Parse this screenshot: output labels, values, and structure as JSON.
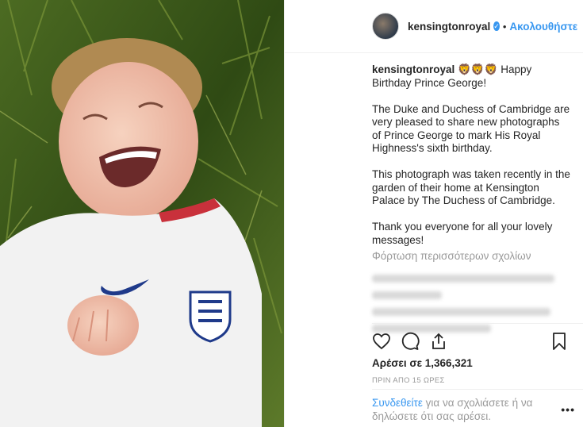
{
  "header": {
    "username": "kensingtonroyal",
    "verified_icon": "verified-badge-icon",
    "separator": "•",
    "follow_label": "Ακολουθήστε"
  },
  "caption": {
    "username": "kensingtonroyal",
    "emojis": "🦁🦁🦁",
    "paragraphs": [
      "Happy Birthday Prince George!",
      "The Duke and Duchess of Cambridge are very pleased to share new photographs of Prince George to mark His Royal Highness's sixth birthday.",
      "This photograph was taken recently in the garden of their home at Kensington Palace by The Duchess of Cambridge.",
      "Thank you everyone for all your lovely messages!"
    ]
  },
  "load_more": "Φόρτωση περισσότερων σχολίων",
  "actions": {
    "like_icon": "heart-icon",
    "comment_icon": "comment-icon",
    "share_icon": "share-icon",
    "save_icon": "bookmark-icon"
  },
  "likes": "Αρέσει σε 1,366,321",
  "time": "ΠΡΙΝ ΑΠΟ 15 ΩΡΕΣ",
  "login": {
    "link_label": "Συνδεθείτε",
    "rest": " για να σχολιάσετε ή να δηλώσετε ότι σας αρέσει."
  },
  "more_label": "•••",
  "colors": {
    "accent": "#3897f0",
    "text": "#262626",
    "muted": "#999999"
  }
}
